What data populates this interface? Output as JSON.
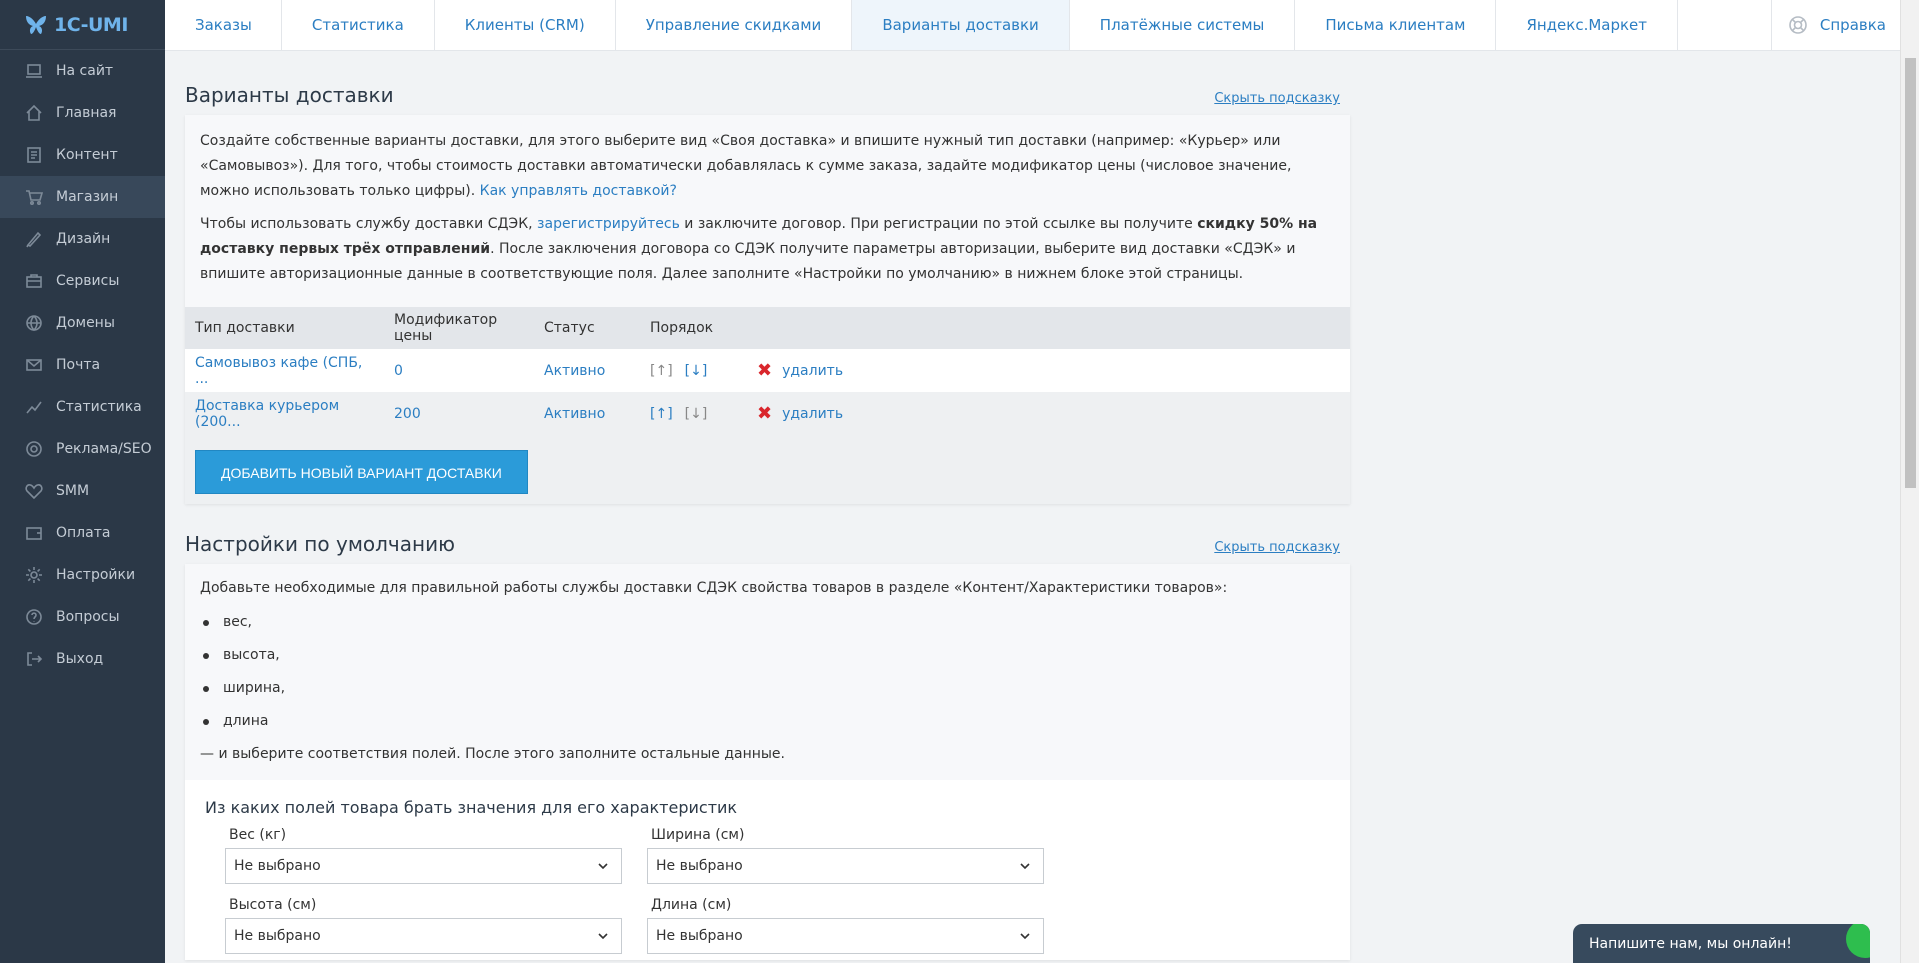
{
  "logo": {
    "text": "1C-UMI"
  },
  "sidebar": {
    "items": [
      {
        "label": "На сайт",
        "icon": "laptop-icon"
      },
      {
        "label": "Главная",
        "icon": "home-icon"
      },
      {
        "label": "Контент",
        "icon": "document-icon"
      },
      {
        "label": "Магазин",
        "icon": "cart-icon"
      },
      {
        "label": "Дизайн",
        "icon": "palette-icon"
      },
      {
        "label": "Сервисы",
        "icon": "briefcase-icon"
      },
      {
        "label": "Домены",
        "icon": "globe-icon"
      },
      {
        "label": "Почта",
        "icon": "mail-icon"
      },
      {
        "label": "Статистика",
        "icon": "chart-icon"
      },
      {
        "label": "Реклама/SEO",
        "icon": "target-icon"
      },
      {
        "label": "SMM",
        "icon": "heart-icon"
      },
      {
        "label": "Оплата",
        "icon": "wallet-icon"
      },
      {
        "label": "Настройки",
        "icon": "gear-icon"
      },
      {
        "label": "Вопросы",
        "icon": "question-icon"
      },
      {
        "label": "Выход",
        "icon": "logout-icon"
      }
    ],
    "active_index": 3
  },
  "tabs": [
    "Заказы",
    "Статистика",
    "Клиенты (CRM)",
    "Управление скидками",
    "Варианты доставки",
    "Платёжные системы",
    "Письма клиентам",
    "Яндекс.Маркет"
  ],
  "active_tab": 4,
  "help": {
    "label": "Справка"
  },
  "delivery": {
    "title": "Варианты доставки",
    "hide_hint": "Скрыть подсказку",
    "hint_p1": "Создайте собственные варианты доставки, для этого выберите вид «Своя доставка» и впишите нужный тип доставки (например: «Курьер» или «Самовывоз»). Для того, чтобы стоимость доставки автоматически добавлялась к сумме заказа, задайте модификатор цены (числовое значение, можно использовать только цифры).",
    "hint_link": "Как управлять доставкой?",
    "hint_p2_a": "Чтобы использовать службу доставки СДЭК, ",
    "hint_p2_link": "зарегистрируйтесь",
    "hint_p2_b": " и заключите договор. При регистрации по этой ссылке вы получите ",
    "hint_p2_bold": "скидку 50% на доставку первых трёх отправлений",
    "hint_p2_c": ". После заключения договора со СДЭК получите параметры авторизации, выберите вид доставки «СДЭК» и впишите авторизационные данные в соответствующие поля. Далее заполните «Настройки по умолчанию» в нижнем блоке этой страницы.",
    "columns": [
      "Тип доставки",
      "Модификатор цены",
      "Статус",
      "Порядок"
    ],
    "rows": [
      {
        "type": "Самовывоз кафе (СПБ, ...",
        "modifier": "0",
        "status": "Активно",
        "up": "[↑]",
        "down": "[↓]",
        "delete": "удалить"
      },
      {
        "type": "Доставка курьером (200...",
        "modifier": "200",
        "status": "Активно",
        "up": "[↑]",
        "down": "[↓]",
        "delete": "удалить"
      }
    ],
    "add_button": "ДОБАВИТЬ НОВЫЙ ВАРИАНТ ДОСТАВКИ"
  },
  "defaults": {
    "title": "Настройки по умолчанию",
    "hide_hint": "Скрыть подсказку",
    "intro": "Добавьте необходимые для правильной работы службы доставки СДЭК свойства товаров в разделе «Контент/Характеристики товаров»:",
    "items": [
      "вес,",
      "высота,",
      "ширина,",
      "длина"
    ],
    "outro": "— и выберите соответствия полей. После этого заполните остальные данные.",
    "form_title": "Из каких полей товара брать значения для его характеристик",
    "fields": [
      {
        "label": "Вес (кг)",
        "value": "Не выбрано"
      },
      {
        "label": "Ширина (см)",
        "value": "Не выбрано"
      },
      {
        "label": "Высота (см)",
        "value": "Не выбрано"
      },
      {
        "label": "Длина (см)",
        "value": "Не выбрано"
      }
    ]
  },
  "chat": {
    "label": "Напишите нам, мы онлайн!"
  },
  "colors": {
    "sidebar_bg": "#2b3847",
    "accent": "#2b7ec2",
    "button": "#2b9bd9",
    "delete": "#d9262c",
    "chat_online": "#2ebe4e"
  }
}
